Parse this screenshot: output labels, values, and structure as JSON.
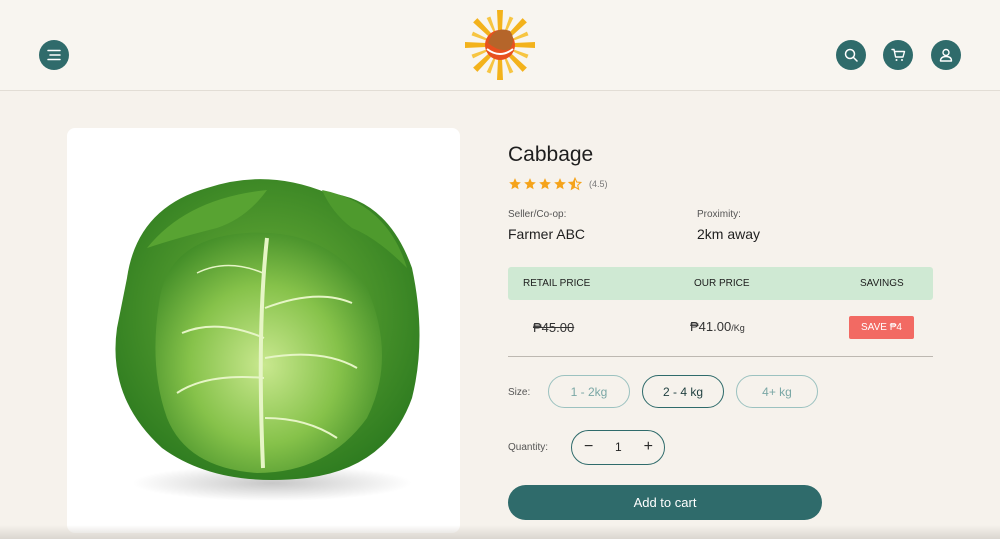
{
  "product": {
    "name": "Cabbage",
    "rating": 4.5,
    "rating_text": "(4.5)",
    "image_icon": "cabbage-illustration"
  },
  "seller": {
    "label": "Seller/Co-op:",
    "value": "Farmer ABC"
  },
  "proximity": {
    "label": "Proximity:",
    "value": "2km away"
  },
  "pricing": {
    "headers": {
      "retail": "RETAIL PRICE",
      "ours": "OUR PRICE",
      "savings": "SAVINGS"
    },
    "retail": "₱45.00",
    "ours": "₱41.00",
    "unit": "/Kg",
    "savings": "SAVE ₱4"
  },
  "size": {
    "label": "Size:",
    "options": [
      "1 - 2kg",
      "2 - 4 kg",
      "4+ kg"
    ],
    "selected": "2 - 4 kg"
  },
  "quantity": {
    "label": "Quantity:",
    "minus": "−",
    "value": "1",
    "plus": "+"
  },
  "add_to_cart": "Add to cart",
  "header": {
    "menu_icon": "menu-icon",
    "logo": "sun-logo",
    "search_icon": "search-icon",
    "cart_icon": "cart-icon",
    "account_icon": "user-icon"
  },
  "colors": {
    "primary": "#2f6b6b",
    "price_header_bg": "#cfe9d3",
    "savings_badge": "#f26a63",
    "star": "#f5a31a",
    "page_bg": "#f6f2ec"
  }
}
